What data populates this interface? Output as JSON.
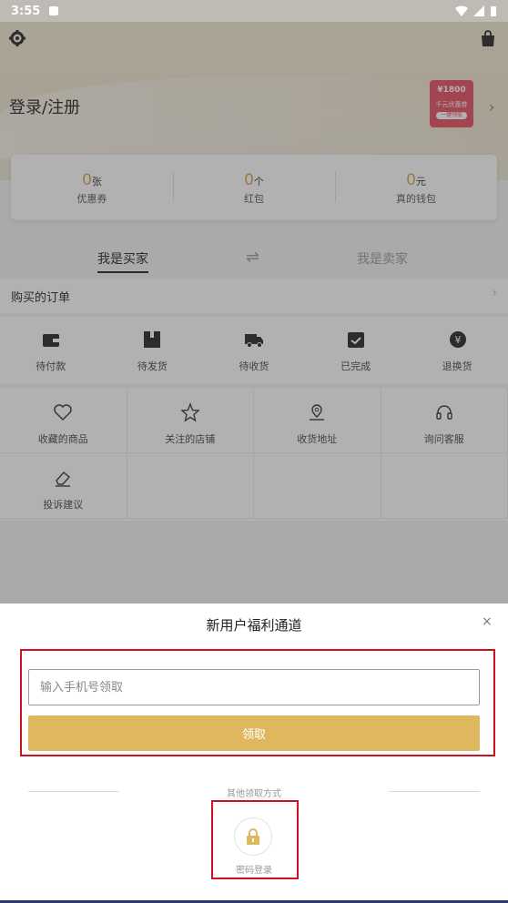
{
  "statusbar": {
    "time": "3:55"
  },
  "header": {
    "login_label": "登录/注册",
    "coupon": {
      "amount": "¥1800",
      "title": "千元优惠券",
      "button": "一键领取"
    }
  },
  "wallet": [
    {
      "value": "0",
      "unit": "张",
      "label": "优惠券"
    },
    {
      "value": "0",
      "unit": "个",
      "label": "红包"
    },
    {
      "value": "0",
      "unit": "元",
      "label": "真的钱包"
    }
  ],
  "tabs": {
    "buyer": "我是买家",
    "swap_icon": "⇌",
    "seller": "我是卖家"
  },
  "orders": {
    "title": "购买的订单",
    "items": [
      {
        "label": "待付款",
        "icon": "wallet-icon"
      },
      {
        "label": "待发货",
        "icon": "box-icon"
      },
      {
        "label": "待收货",
        "icon": "truck-icon"
      },
      {
        "label": "已完成",
        "icon": "calendar-check-icon"
      },
      {
        "label": "退换货",
        "icon": "yen-return-icon"
      }
    ]
  },
  "services": [
    {
      "label": "收藏的商品",
      "icon": "heart-icon"
    },
    {
      "label": "关注的店铺",
      "icon": "star-icon"
    },
    {
      "label": "收货地址",
      "icon": "location-icon"
    },
    {
      "label": "询问客服",
      "icon": "headset-icon"
    },
    {
      "label": "投诉建议",
      "icon": "eraser-icon"
    }
  ],
  "sheet": {
    "title": "新用户福利通道",
    "close": "×",
    "phone_placeholder": "输入手机号领取",
    "claim_button": "领取",
    "other_methods": "其他领取方式",
    "password_login": "密码登录"
  },
  "colors": {
    "accent": "#dfb75f",
    "highlight": "#d0101f",
    "number": "#d9a441"
  }
}
